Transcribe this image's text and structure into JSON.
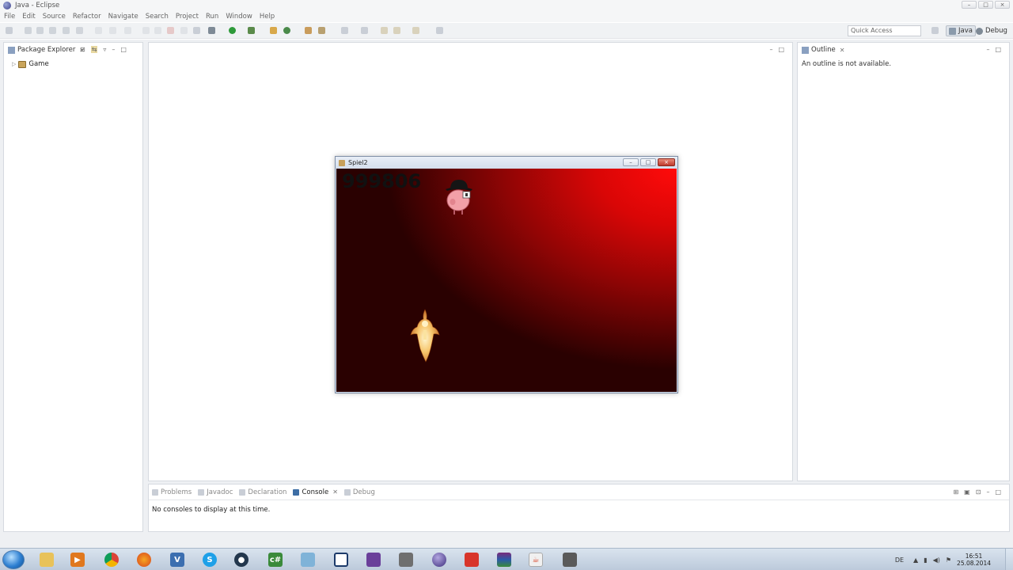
{
  "window": {
    "title": "Java - Eclipse",
    "controls": [
      "–",
      "□",
      "×"
    ]
  },
  "menu": [
    "File",
    "Edit",
    "Source",
    "Refactor",
    "Navigate",
    "Search",
    "Project",
    "Run",
    "Window",
    "Help"
  ],
  "toolbar": {
    "quick_access_placeholder": "Quick Access",
    "perspectives": [
      "Java",
      "Debug"
    ]
  },
  "package_explorer": {
    "tab_label": "Package Explorer",
    "items": [
      {
        "label": "Game",
        "icon": "java-project-icon"
      }
    ]
  },
  "outline": {
    "tab_label": "Outline",
    "message": "An outline is not available."
  },
  "bottom_panel": {
    "tabs": [
      "Problems",
      "Javadoc",
      "Declaration",
      "Console",
      "Debug"
    ],
    "active_tab": "Console",
    "message": "No consoles to display at this time."
  },
  "game_window": {
    "title": "Spiel2",
    "score": "999806",
    "controls": [
      "–",
      "□",
      "×"
    ],
    "sprites": [
      "pig-with-bowler-hat-sprite",
      "flame-figure-sprite"
    ]
  },
  "taskbar": {
    "apps": [
      "file-explorer-icon",
      "media-player-icon",
      "chrome-icon",
      "firefox-icon",
      "vs-icon",
      "skype-icon",
      "steam-icon",
      "csharp-icon",
      "app-icon",
      "window-icon",
      "visual-studio-icon",
      "game-icon",
      "eclipse-icon",
      "git-icon",
      "winrar-icon",
      "java-icon",
      "other-icon"
    ],
    "language": "DE",
    "time": "16:51",
    "date": "25.08.2014"
  }
}
